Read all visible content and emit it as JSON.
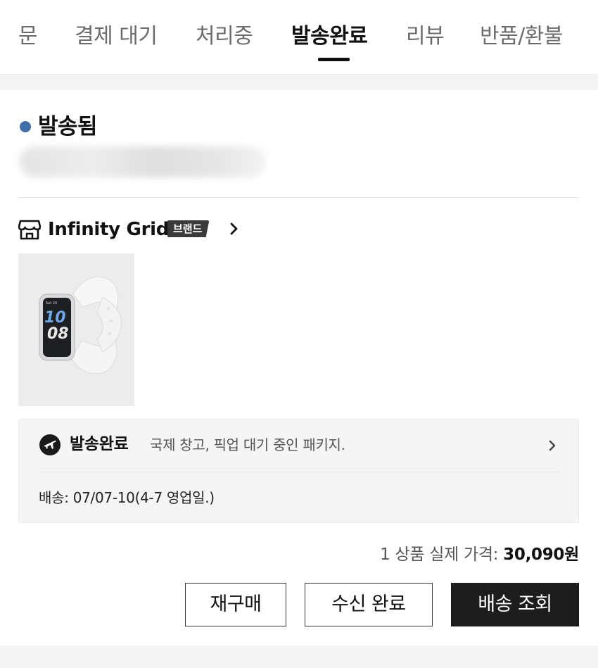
{
  "tabs": [
    {
      "label": "문",
      "active": false
    },
    {
      "label": "결제 대기",
      "active": false
    },
    {
      "label": "처리중",
      "active": false
    },
    {
      "label": "발송완료",
      "active": true
    },
    {
      "label": "리뷰",
      "active": false
    },
    {
      "label": "반품/환불",
      "active": false
    }
  ],
  "order": {
    "status_title": "발송됨",
    "status_color": "#3f6ea8"
  },
  "store": {
    "name": "Infinity Grid",
    "badge": "브랜드",
    "icon": "store-icon"
  },
  "product": {
    "image": "smartwatch-band-thumbnail",
    "watch_date": "Sat 20",
    "watch_time_hours": "10",
    "watch_time_minutes": "08"
  },
  "shipping": {
    "status": "발송완료",
    "description": "국제 창고, 픽업 대기 중인 패키지.",
    "delivery": "배송: 07/07-10(4-7 영업일.)",
    "icon": "airplane-icon"
  },
  "price": {
    "label": "1 상품 실제 가격: ",
    "amount": "30,090원"
  },
  "buttons": {
    "rebuy": "재구매",
    "received": "수신 완료",
    "track": "배송 조회"
  }
}
